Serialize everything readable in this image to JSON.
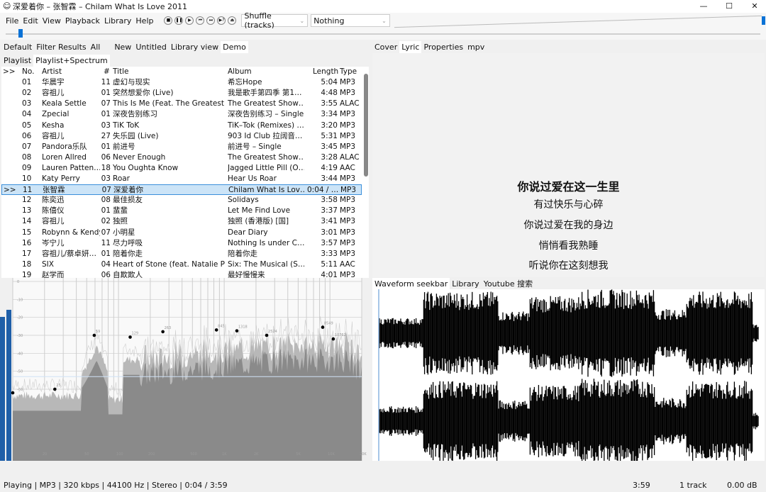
{
  "window": {
    "title": "深爱着你 – 张智霖 – Chilam What Is Love 2011",
    "minimize": "—",
    "maximize": "☐",
    "close": "✕"
  },
  "menu": [
    "File",
    "Edit",
    "View",
    "Playback",
    "Library",
    "Help"
  ],
  "transport": [
    {
      "icon": "stop-icon",
      "glyph": "■"
    },
    {
      "icon": "pause-icon",
      "glyph": "❚❚"
    },
    {
      "icon": "play-icon",
      "glyph": "▶"
    },
    {
      "icon": "previous-icon",
      "glyph": "⏮"
    },
    {
      "icon": "next-icon",
      "glyph": "⏭"
    },
    {
      "icon": "random-icon",
      "glyph": "▶?"
    },
    {
      "icon": "eject-icon",
      "glyph": "⏏"
    }
  ],
  "order_select": "Shuffle (tracks)",
  "stop_after_select": "Nothing",
  "seek_progress": 0.017,
  "volume_level": 1.0,
  "playlist_tabs": [
    "Default",
    "Filter Results",
    "All",
    "New",
    "Untitled",
    "Library view",
    "Demo"
  ],
  "active_playlist_tab": "Demo",
  "layout_tabs": [
    "Playlist",
    "Playlist+Spectrum"
  ],
  "right_tabs": [
    "Cover",
    "Lyric",
    "Properties",
    "mpv"
  ],
  "bottom_right_tabs": [
    "Waveform seekbar",
    "Library",
    "Youtube 搜索"
  ],
  "columns": {
    "playing": ">>",
    "no": "No.",
    "artist": "Artist",
    "track": "#",
    "title": "Title",
    "album": "Album",
    "length": "Length",
    "type": "Type"
  },
  "rows": [
    [
      "",
      "01",
      "华晨宇",
      "11",
      "虚幻与现实",
      "希忘Hope",
      "5:04",
      "MP3"
    ],
    [
      "",
      "02",
      "容祖儿",
      "01",
      "突然想爱你 (Live)",
      "我是歌手第四季 第1…",
      "4:48",
      "MP3"
    ],
    [
      "",
      "03",
      "Keala Settle",
      "07",
      "This Is Me (Feat. The Greatest …",
      "The Greatest Show…",
      "3:55",
      "ALAC"
    ],
    [
      "",
      "04",
      "Zpecial",
      "01",
      "深夜告别练习",
      "深夜告别练习 – Single",
      "3:34",
      "MP3"
    ],
    [
      "",
      "05",
      "Kesha",
      "03",
      "TiK ToK",
      "TiK–Tok (Remixes) …",
      "3:20",
      "MP3"
    ],
    [
      "",
      "06",
      "容祖儿",
      "27",
      "失乐园 (Live)",
      "903 Id Club 拉阔音…",
      "5:31",
      "MP3"
    ],
    [
      "",
      "07",
      "Pandora乐队",
      "01",
      "前进号",
      "前进号 – Single",
      "3:45",
      "MP3"
    ],
    [
      "",
      "08",
      "Loren Allred",
      "06",
      "Never Enough",
      "The Greatest Show…",
      "3:28",
      "ALAC"
    ],
    [
      "",
      "09",
      "Lauren Patten…",
      "18",
      "You Oughta Know",
      "Jagged Little Pill (O…",
      "4:19",
      "AAC"
    ],
    [
      "",
      "10",
      "Katy Perry",
      "03",
      "Roar",
      "Hear Us Roar",
      "3:44",
      "MP3"
    ],
    [
      ">>",
      "11",
      "张智霖",
      "07",
      "深爱着你",
      "Chilam What Is Lov…",
      "0:04 / …",
      "MP3"
    ],
    [
      "",
      "12",
      "陈奕迅",
      "08",
      "最佳损友",
      "Solidays",
      "3:58",
      "MP3"
    ],
    [
      "",
      "13",
      "陈僖仪",
      "01",
      "蜚蜚",
      "Let Me Find Love",
      "3:37",
      "MP3"
    ],
    [
      "",
      "14",
      "容祖儿",
      "02",
      "独照",
      "独照 (香港版) [国]",
      "3:41",
      "MP3"
    ],
    [
      "",
      "15",
      "Robynn & Kendy",
      "07",
      "小明星",
      "Dear Diary",
      "3:01",
      "MP3"
    ],
    [
      "",
      "16",
      "岑宁儿",
      "11",
      "尽力呼吸",
      "Nothing Is under C…",
      "3:57",
      "MP3"
    ],
    [
      "",
      "17",
      "容祖儿/蔡卓妍…",
      "01",
      "陪着你走",
      "陪着你走",
      "3:33",
      "MP3"
    ],
    [
      "",
      "18",
      "SIX",
      "04",
      "Heart of Stone (feat. Natalie P…",
      "Six: The Musical (S…",
      "5:11",
      "AAC"
    ],
    [
      "",
      "19",
      "赵学而",
      "06",
      "自欺欺人",
      "最好慢慢来",
      "4:01",
      "MP3"
    ]
  ],
  "lyrics": [
    "你说过爱在这一生里",
    "有过快乐与心碎",
    "你说过爱在我的身边",
    "悄悄看我熟睡",
    "听说你在这刻想我"
  ],
  "chart_data": {
    "type": "area",
    "x_scale": "log",
    "xlim": [
      10,
      20000
    ],
    "ylim": [
      -95,
      0
    ],
    "grid": true,
    "x_ticks": [
      "20",
      "50",
      "100",
      "200",
      "500",
      "1K",
      "2K",
      "5K",
      "10K",
      "20K"
    ],
    "y_ticks": [
      "0",
      "-10",
      "-20",
      "-30",
      "-40",
      "-50",
      "-60",
      "-70",
      "-80",
      "-90"
    ],
    "peaks": [
      {
        "x": 10,
        "y": -62,
        "label": ""
      },
      {
        "x": 25,
        "y": -60,
        "label": "25"
      },
      {
        "x": 59,
        "y": -30,
        "label": "59"
      },
      {
        "x": 129,
        "y": -31,
        "label": "129"
      },
      {
        "x": 263,
        "y": -28,
        "label": "263"
      },
      {
        "x": 845,
        "y": -27,
        "label": "845"
      },
      {
        "x": 1318,
        "y": -27.5,
        "label": "1318"
      },
      {
        "x": 2524,
        "y": -30,
        "label": "2524"
      },
      {
        "x": 8549,
        "y": -25.5,
        "label": "8549"
      },
      {
        "x": 10762,
        "y": -32,
        "label": "10762"
      }
    ],
    "colors": {
      "fill_dark": "#8a8a8a",
      "fill_light": "#b8b8b8",
      "line": "#cfcfcf",
      "vu": "#1f5fa8"
    }
  },
  "status": {
    "text": "Playing | MP3 | 320 kbps | 44100 Hz | Stereo | 0:04 / 3:59",
    "total": "3:59",
    "track": "1 track",
    "gain": "0.00 dB"
  }
}
